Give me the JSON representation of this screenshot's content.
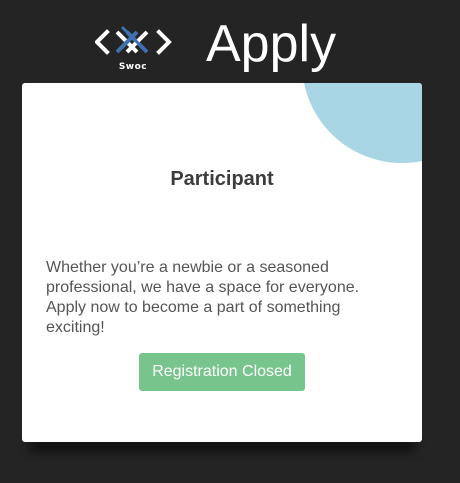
{
  "header": {
    "logo_text": "Swoc",
    "title": "Apply"
  },
  "card": {
    "title": "Participant",
    "description": "Whether you’re a newbie or a seasoned professional, we have a space for everyone. Apply now to become a part of something exciting!",
    "button_label": "Registration Closed",
    "button_state": "disabled"
  },
  "colors": {
    "page_background": "#242424",
    "card_background": "#ffffff",
    "accent_circle": "#a9d6e5",
    "button_background": "#77c58c",
    "logo_blue": "#3f6fb0"
  },
  "icons": {
    "logo": "swoc-logo-icon"
  }
}
